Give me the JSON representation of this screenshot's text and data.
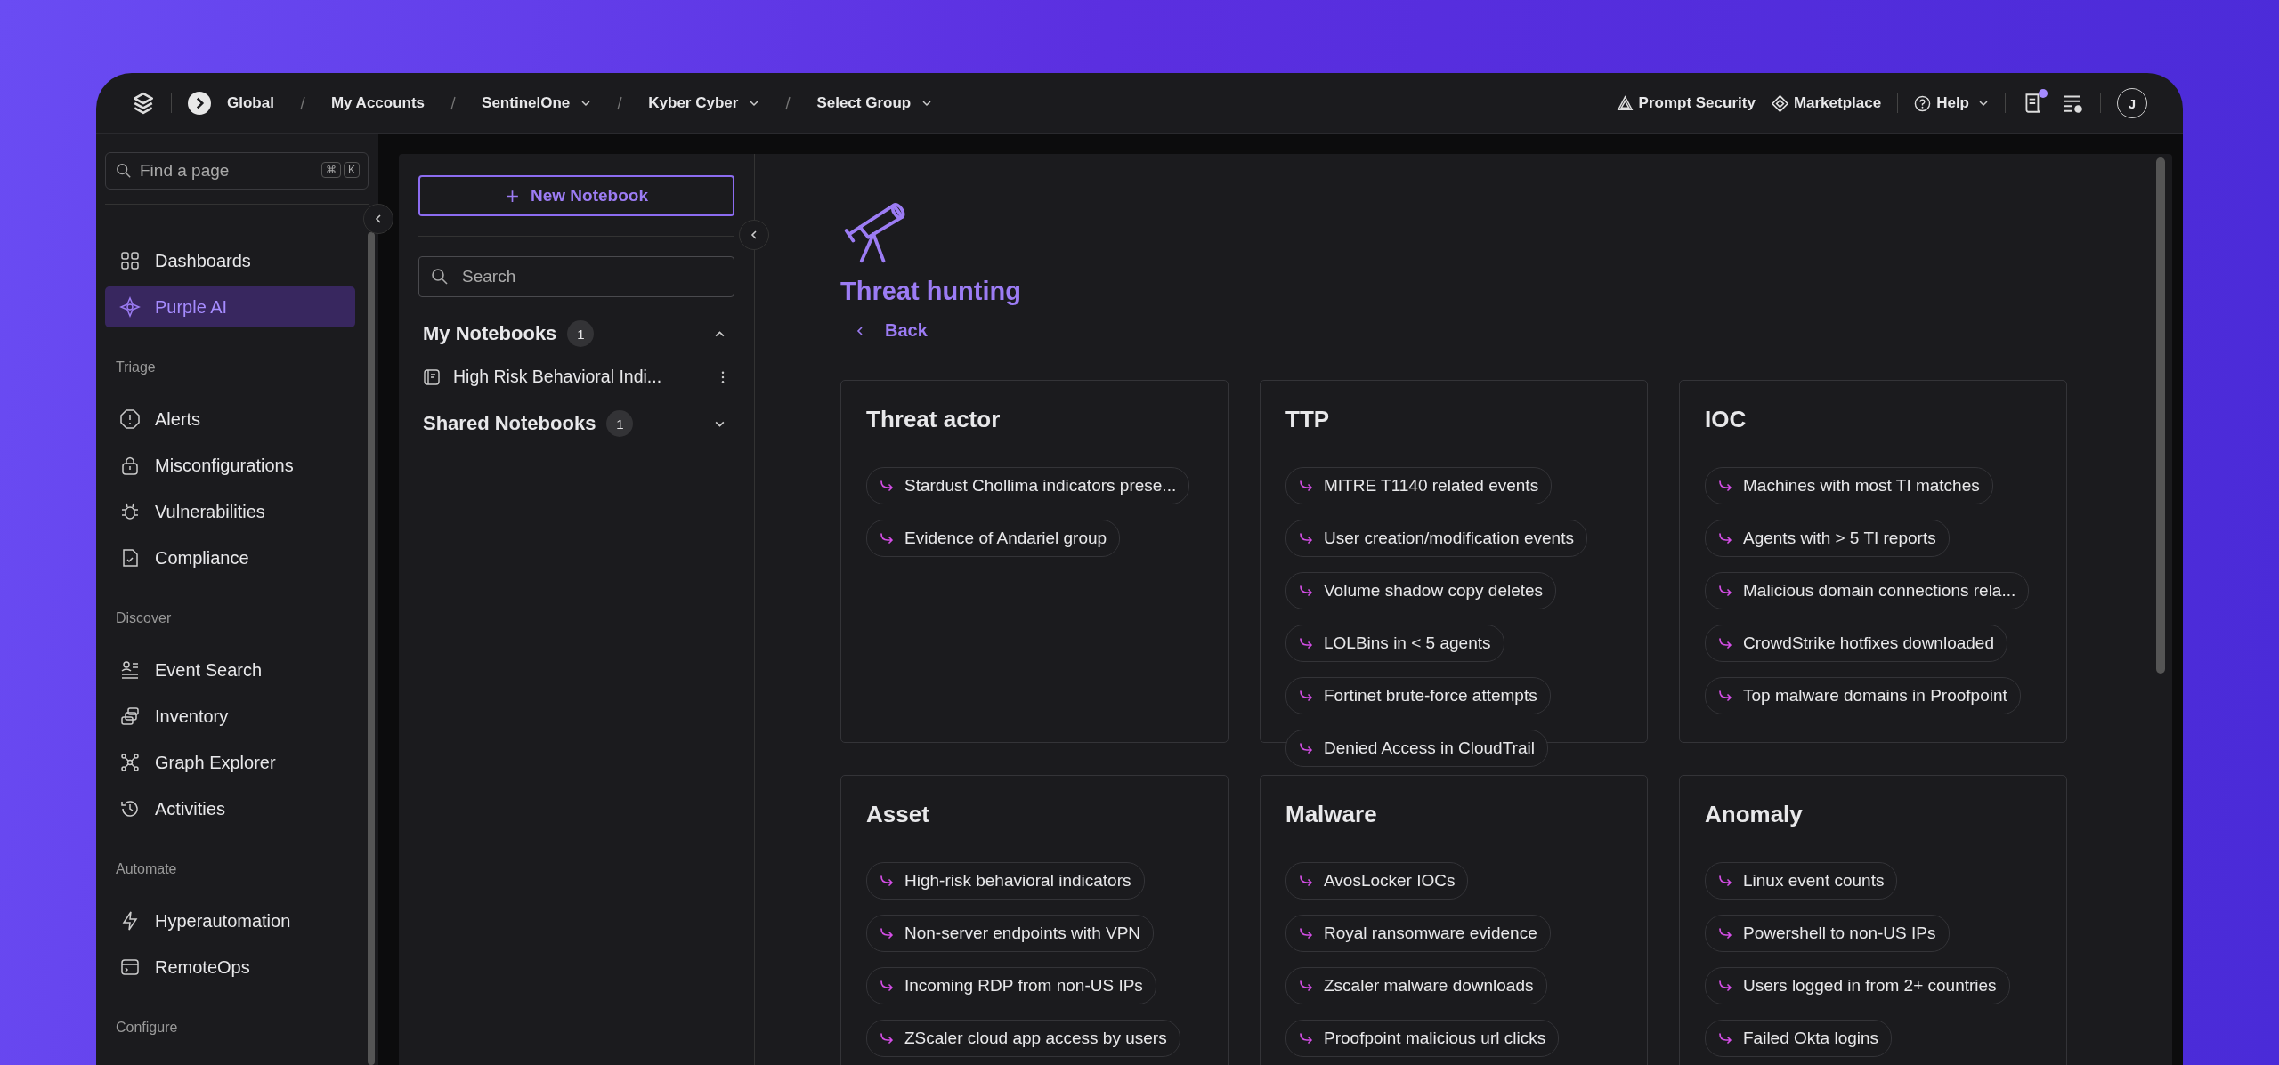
{
  "topbar": {
    "breadcrumbs": [
      {
        "label": "Global",
        "link": false,
        "dropdown": false
      },
      {
        "label": "My Accounts",
        "link": true,
        "dropdown": false
      },
      {
        "label": "SentinelOne",
        "link": true,
        "dropdown": true
      },
      {
        "label": "Kyber Cyber",
        "link": false,
        "dropdown": true
      },
      {
        "label": "Select Group",
        "link": false,
        "dropdown": true
      }
    ],
    "actions": [
      {
        "label": "Prompt Security",
        "dropdown": false
      },
      {
        "label": "Marketplace",
        "dropdown": false
      },
      {
        "label": "Help",
        "dropdown": true
      }
    ],
    "notes_unread": true,
    "avatar": "J"
  },
  "sidebar": {
    "search": {
      "placeholder": "Find a page",
      "shortcut": [
        "⌘",
        "K"
      ]
    },
    "sections": [
      {
        "items": [
          {
            "label": "Dashboards",
            "selected": false
          },
          {
            "label": "Purple AI",
            "selected": true
          }
        ]
      },
      {
        "title": "Triage",
        "items": [
          {
            "label": "Alerts",
            "selected": false
          },
          {
            "label": "Misconfigurations",
            "selected": false
          },
          {
            "label": "Vulnerabilities",
            "selected": false
          },
          {
            "label": "Compliance",
            "selected": false
          }
        ]
      },
      {
        "title": "Discover",
        "items": [
          {
            "label": "Event Search",
            "selected": false
          },
          {
            "label": "Inventory",
            "selected": false
          },
          {
            "label": "Graph Explorer",
            "selected": false
          },
          {
            "label": "Activities",
            "selected": false
          }
        ]
      },
      {
        "title": "Automate",
        "items": [
          {
            "label": "Hyperautomation",
            "selected": false
          },
          {
            "label": "RemoteOps",
            "selected": false
          }
        ]
      },
      {
        "title": "Configure"
      }
    ]
  },
  "notebooks": {
    "new_button": "New Notebook",
    "search": {
      "placeholder": "Search"
    },
    "groups": [
      {
        "title": "My Notebooks",
        "count": "1",
        "expanded": true,
        "items": [
          {
            "title": "High Risk Behavioral Indi..."
          }
        ]
      },
      {
        "title": "Shared Notebooks",
        "count": "1",
        "expanded": false
      }
    ]
  },
  "content": {
    "title": "Threat hunting",
    "back": "Back",
    "categories": [
      {
        "title": "Threat actor",
        "queries": [
          "Stardust Chollima indicators prese...",
          "Evidence of Andariel group"
        ]
      },
      {
        "title": "TTP",
        "queries": [
          "MITRE T1140 related events",
          "User creation/modification events",
          "Volume shadow copy deletes",
          "LOLBins in < 5 agents",
          "Fortinet brute-force attempts",
          "Denied Access in CloudTrail"
        ]
      },
      {
        "title": "IOC",
        "queries": [
          "Machines with most TI matches",
          "Agents with > 5 TI reports",
          "Malicious domain connections rela...",
          "CrowdStrike hotfixes downloaded",
          "Top malware domains in Proofpoint"
        ]
      },
      {
        "title": "Asset",
        "queries": [
          "High-risk behavioral indicators",
          "Non-server endpoints with VPN",
          "Incoming RDP from non-US IPs",
          "ZScaler cloud app access by users"
        ]
      },
      {
        "title": "Malware",
        "queries": [
          "AvosLocker IOCs",
          "Royal ransomware evidence",
          "Zscaler malware downloads",
          "Proofpoint malicious url clicks"
        ]
      },
      {
        "title": "Anomaly",
        "queries": [
          "Linux event counts",
          "Powershell to non-US IPs",
          "Users logged in from 2+ countries",
          "Failed Okta logins"
        ]
      }
    ]
  }
}
